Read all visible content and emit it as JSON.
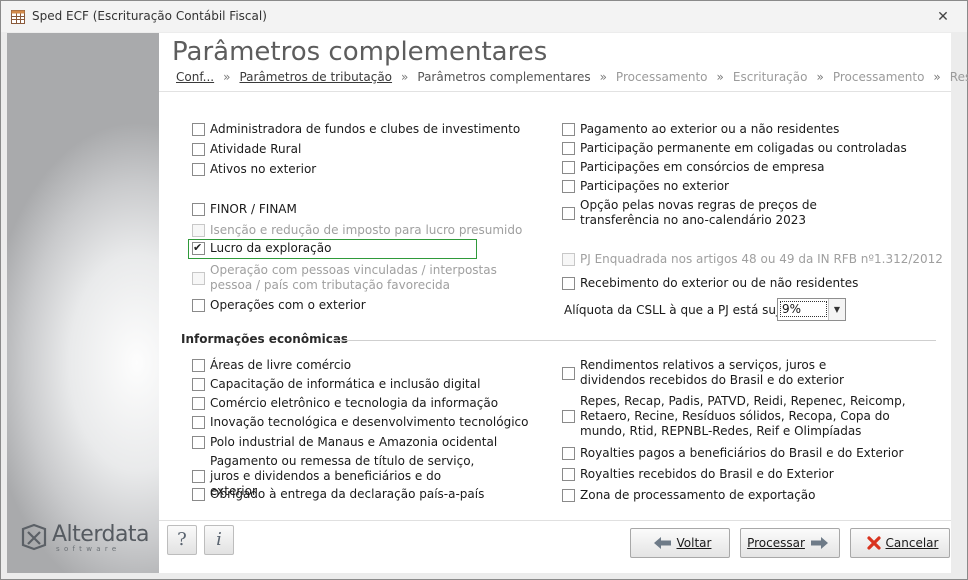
{
  "window": {
    "title": "Sped ECF (Escrituração Contábil Fiscal)",
    "close_glyph": "✕",
    "app_icon": "spreadsheet-icon"
  },
  "brand": {
    "name": "Alterdata",
    "sub": "software"
  },
  "header": {
    "title": "Parâmetros complementares",
    "breadcrumb": [
      "Conf...",
      "Parâmetros de tributação",
      "Parâmetros complementares",
      "Processamento",
      "Escrituração",
      "Processamento",
      "Resultado"
    ],
    "separator": "»"
  },
  "left_options": [
    {
      "label": "Administradora de fundos e clubes de investimento",
      "checked": false,
      "enabled": true
    },
    {
      "label": "Atividade Rural",
      "checked": false,
      "enabled": true
    },
    {
      "label": "Ativos no exterior",
      "checked": false,
      "enabled": true
    },
    {
      "label": "FINOR / FINAM",
      "checked": false,
      "enabled": true
    },
    {
      "label": "Isenção e redução de imposto para lucro presumido",
      "checked": false,
      "enabled": false
    },
    {
      "label": "Lucro da exploração",
      "checked": true,
      "enabled": true
    },
    {
      "label": "Operação com pessoas vinculadas / interpostas pessoa / país com tributação favorecida",
      "checked": false,
      "enabled": false
    },
    {
      "label": "Operações com o exterior",
      "checked": false,
      "enabled": true
    }
  ],
  "right_options": [
    {
      "label": "Pagamento ao exterior ou a não residentes",
      "checked": false,
      "enabled": true
    },
    {
      "label": "Participação permanente em coligadas ou controladas",
      "checked": false,
      "enabled": true
    },
    {
      "label": "Participações em consórcios de empresa",
      "checked": false,
      "enabled": true
    },
    {
      "label": "Participações no exterior",
      "checked": false,
      "enabled": true
    },
    {
      "label": "Opção pelas novas regras de preços de transferência no ano-calendário 2023",
      "checked": false,
      "enabled": true
    },
    {
      "label": "PJ Enquadrada nos artigos 48 ou 49 da IN RFB nº1.312/2012",
      "checked": false,
      "enabled": false
    },
    {
      "label": "Recebimento do exterior ou de não residentes",
      "checked": false,
      "enabled": true
    }
  ],
  "aliquota": {
    "label": "Alíquota da CSLL à que a PJ está sujeita:",
    "value": "9%"
  },
  "economic": {
    "title": "Informações econômicas",
    "left": [
      {
        "label": "Áreas de livre comércio",
        "checked": false
      },
      {
        "label": "Capacitação de informática e inclusão digital",
        "checked": false
      },
      {
        "label": "Comércio eletrônico e tecnologia da informação",
        "checked": false
      },
      {
        "label": "Inovação tecnológica e desenvolvimento tecnológico",
        "checked": false
      },
      {
        "label": "Polo industrial de Manaus e Amazonia ocidental",
        "checked": false
      },
      {
        "label": "Pagamento ou remessa de título de serviço, juros e dividendos a beneficiários e do exterior",
        "checked": false
      },
      {
        "label": "Obrigado à entrega da declaração país-a-país",
        "checked": false
      }
    ],
    "right": [
      {
        "label": "Rendimentos relativos a serviços, juros e dividendos recebidos do Brasil e do exterior",
        "checked": false
      },
      {
        "label": "Repes, Recap, Padis, PATVD, Reidi, Repenec, Reicomp, Retaero, Recine, Resíduos sólidos, Recopa, Copa do mundo, Rtid, REPNBL-Redes, Reif e Olimpíadas",
        "checked": false
      },
      {
        "label": "Royalties pagos a beneficiários  do Brasil e do Exterior",
        "checked": false
      },
      {
        "label": "Royalties recebidos do Brasil e do Exterior",
        "checked": false
      },
      {
        "label": "Zona de processamento de exportação",
        "checked": false
      }
    ]
  },
  "footer": {
    "help_glyph": "?",
    "info_glyph": "i",
    "back_label": "Voltar",
    "process_label": "Processar",
    "cancel_label": "Cancelar",
    "accent_colors": {
      "arrow": "#6e7b88",
      "cancel": "#d9331f"
    }
  }
}
